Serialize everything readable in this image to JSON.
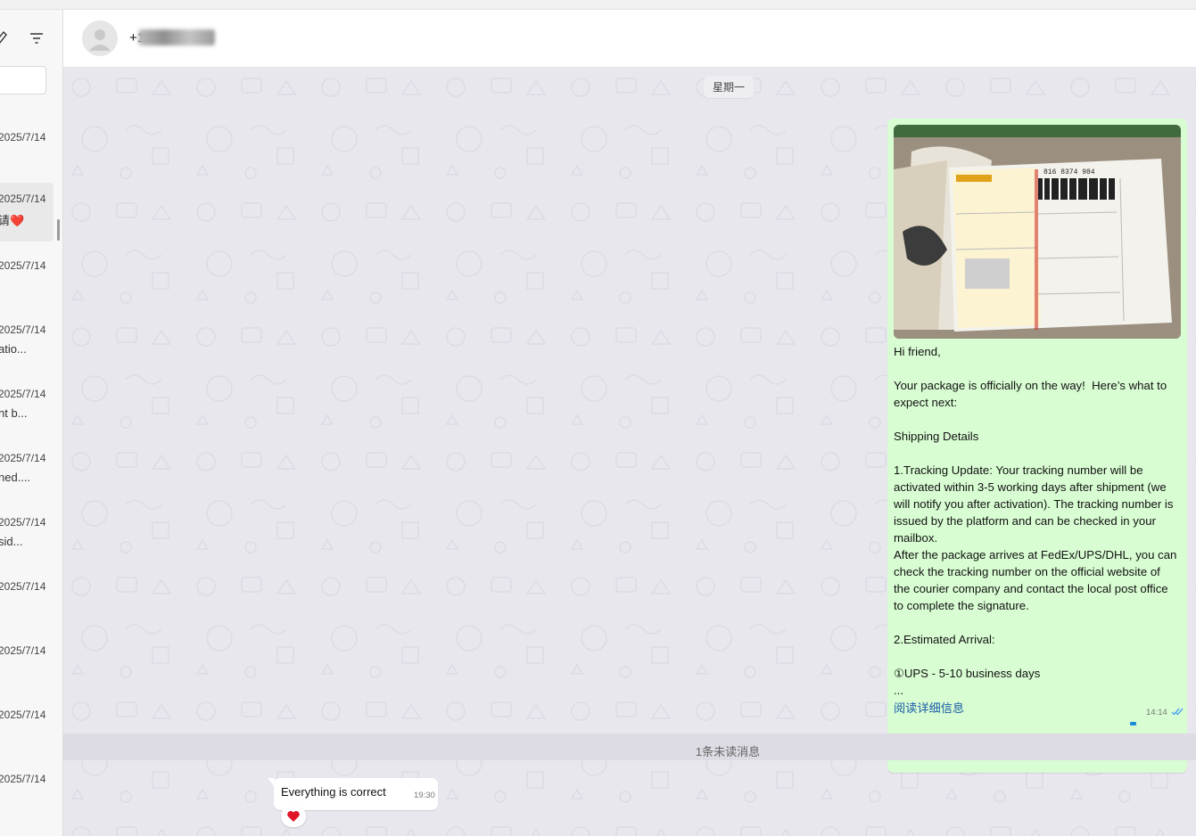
{
  "header": {
    "contact_name": "+1"
  },
  "sidebar": {
    "items": [
      {
        "date": "2025/7/14",
        "preview": ""
      },
      {
        "date": "2025/7/14",
        "preview": "请❤️"
      },
      {
        "date": "2025/7/14",
        "preview": ""
      },
      {
        "date": "2025/7/14",
        "preview": "atio..."
      },
      {
        "date": "2025/7/14",
        "preview": "nt b..."
      },
      {
        "date": "2025/7/14",
        "preview": "ned...."
      },
      {
        "date": "2025/7/14",
        "preview": "sid..."
      },
      {
        "date": "2025/7/14",
        "preview": ""
      },
      {
        "date": "2025/7/14",
        "preview": ""
      },
      {
        "date": "2025/7/14",
        "preview": ""
      },
      {
        "date": "2025/7/14",
        "preview": ""
      }
    ]
  },
  "chat": {
    "date_separator": "星期一",
    "outgoing": {
      "text": "Hi friend,\n\nYour package is officially on the way!  Here’s what to expect next:\n\nShipping Details\n\n1.Tracking Update: Your tracking number will be activated within 3-5 working days after shipment (we will notify you after activation). The tracking number is issued by the platform and can be checked in your mailbox.\nAfter the package arrives at FedEx/UPS/DHL, you can check the tracking number on the official website of the courier company and contact the local post office to complete the signature.\n\n2.Estimated Arrival:\n\n①UPS - 5-10 business days\n...",
      "read_more": "阅读详细信息",
      "time": "14:14",
      "photo_label": "816 8374 984"
    },
    "unread_notice": "1条未读消息",
    "incoming": {
      "text": "Everything is correct",
      "time": "19:30",
      "reaction": "❤️"
    }
  }
}
